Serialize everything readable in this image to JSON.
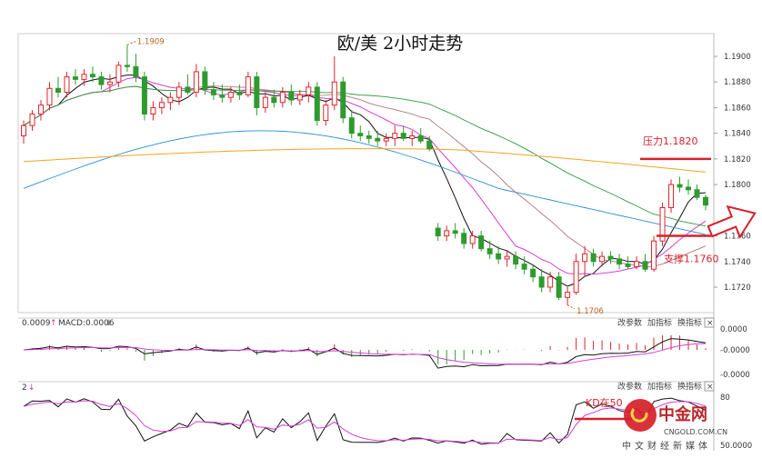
{
  "chart_data": {
    "type": "candlestick",
    "title": "欧/美 2小时走势",
    "y_ticks": [
      "1.1900",
      "1.1880",
      "1.1860",
      "1.1840",
      "1.1820",
      "1.1800",
      "1.1760",
      "1.1740",
      "1.1720"
    ],
    "ylim": [
      1.17,
      1.191
    ],
    "high_label": "1.1909",
    "low_label": "1.1706",
    "resistance": {
      "label": "压力1.1820",
      "value": 1.182
    },
    "support": {
      "label": "支撑1.1760",
      "value": 1.176
    },
    "candles": [
      [
        1.1838,
        1.185,
        1.1832,
        1.1846
      ],
      [
        1.1846,
        1.1858,
        1.1842,
        1.1855
      ],
      [
        1.1855,
        1.1866,
        1.185,
        1.1862
      ],
      [
        1.1862,
        1.188,
        1.1858,
        1.1875
      ],
      [
        1.1875,
        1.1884,
        1.1868,
        1.1872
      ],
      [
        1.1872,
        1.1888,
        1.1868,
        1.1884
      ],
      [
        1.1884,
        1.189,
        1.1878,
        1.1882
      ],
      [
        1.1882,
        1.189,
        1.1877,
        1.1886
      ],
      [
        1.1886,
        1.1892,
        1.188,
        1.1884
      ],
      [
        1.1884,
        1.1888,
        1.1874,
        1.1878
      ],
      [
        1.1878,
        1.1886,
        1.1872,
        1.188
      ],
      [
        1.188,
        1.1896,
        1.1876,
        1.1893
      ],
      [
        1.1893,
        1.1909,
        1.1888,
        1.1892
      ],
      [
        1.1892,
        1.1902,
        1.188,
        1.1884
      ],
      [
        1.1884,
        1.1888,
        1.185,
        1.1855
      ],
      [
        1.1855,
        1.1865,
        1.185,
        1.186
      ],
      [
        1.186,
        1.1868,
        1.1855,
        1.1864
      ],
      [
        1.1864,
        1.1872,
        1.1858,
        1.1868
      ],
      [
        1.1868,
        1.188,
        1.1862,
        1.1876
      ],
      [
        1.1876,
        1.1886,
        1.187,
        1.1872
      ],
      [
        1.1872,
        1.1894,
        1.1868,
        1.1888
      ],
      [
        1.1888,
        1.1892,
        1.187,
        1.1874
      ],
      [
        1.1874,
        1.188,
        1.1866,
        1.187
      ],
      [
        1.187,
        1.1878,
        1.1864,
        1.1868
      ],
      [
        1.1868,
        1.1876,
        1.1864,
        1.1872
      ],
      [
        1.1872,
        1.1878,
        1.1866,
        1.187
      ],
      [
        1.187,
        1.1888,
        1.1868,
        1.1884
      ],
      [
        1.1884,
        1.1888,
        1.1854,
        1.186
      ],
      [
        1.186,
        1.1872,
        1.1856,
        1.1868
      ],
      [
        1.1868,
        1.1874,
        1.186,
        1.1864
      ],
      [
        1.1864,
        1.1876,
        1.186,
        1.1872
      ],
      [
        1.1872,
        1.1878,
        1.1862,
        1.1866
      ],
      [
        1.1866,
        1.1874,
        1.1862,
        1.187
      ],
      [
        1.187,
        1.188,
        1.1864,
        1.1876
      ],
      [
        1.1876,
        1.188,
        1.1846,
        1.185
      ],
      [
        1.185,
        1.1866,
        1.1846,
        1.1862
      ],
      [
        1.1862,
        1.19,
        1.1858,
        1.188
      ],
      [
        1.188,
        1.1884,
        1.1848,
        1.1852
      ],
      [
        1.1852,
        1.1858,
        1.1836,
        1.184
      ],
      [
        1.184,
        1.1846,
        1.1834,
        1.1838
      ],
      [
        1.1838,
        1.1842,
        1.1832,
        1.1836
      ],
      [
        1.1836,
        1.1842,
        1.183,
        1.1834
      ],
      [
        1.1834,
        1.184,
        1.183,
        1.1836
      ],
      [
        1.1836,
        1.1846,
        1.183,
        1.184
      ],
      [
        1.184,
        1.1846,
        1.1834,
        1.1836
      ],
      [
        1.1836,
        1.1842,
        1.183,
        1.1838
      ],
      [
        1.1838,
        1.1844,
        1.1832,
        1.1834
      ],
      [
        1.1834,
        1.1838,
        1.1826,
        1.1828
      ],
      [
        1.1766,
        1.177,
        1.1756,
        1.176
      ],
      [
        1.176,
        1.1768,
        1.1756,
        1.1764
      ],
      [
        1.1764,
        1.177,
        1.1758,
        1.1762
      ],
      [
        1.1762,
        1.1766,
        1.175,
        1.1754
      ],
      [
        1.1754,
        1.1764,
        1.175,
        1.176
      ],
      [
        1.176,
        1.1764,
        1.1748,
        1.175
      ],
      [
        1.175,
        1.1756,
        1.1742,
        1.1746
      ],
      [
        1.1746,
        1.1752,
        1.1738,
        1.1742
      ],
      [
        1.1742,
        1.1748,
        1.1736,
        1.1744
      ],
      [
        1.1744,
        1.1748,
        1.1734,
        1.1738
      ],
      [
        1.1738,
        1.1744,
        1.173,
        1.1734
      ],
      [
        1.1734,
        1.1738,
        1.1724,
        1.1728
      ],
      [
        1.1728,
        1.1734,
        1.1716,
        1.172
      ],
      [
        1.172,
        1.1732,
        1.1716,
        1.1728
      ],
      [
        1.1728,
        1.1732,
        1.171,
        1.1712
      ],
      [
        1.1712,
        1.172,
        1.1706,
        1.1716
      ],
      [
        1.1716,
        1.1746,
        1.1714,
        1.174
      ],
      [
        1.174,
        1.1752,
        1.1728,
        1.1746
      ],
      [
        1.1746,
        1.175,
        1.1736,
        1.174
      ],
      [
        1.174,
        1.1748,
        1.1736,
        1.1744
      ],
      [
        1.1744,
        1.1748,
        1.1738,
        1.1742
      ],
      [
        1.1742,
        1.1746,
        1.1734,
        1.1738
      ],
      [
        1.1738,
        1.1744,
        1.1734,
        1.1736
      ],
      [
        1.1736,
        1.1744,
        1.1734,
        1.174
      ],
      [
        1.174,
        1.1746,
        1.1732,
        1.1734
      ],
      [
        1.1734,
        1.176,
        1.1732,
        1.1756
      ],
      [
        1.1756,
        1.1786,
        1.1752,
        1.1782
      ],
      [
        1.1782,
        1.1804,
        1.1778,
        1.18
      ],
      [
        1.18,
        1.1806,
        1.1794,
        1.1798
      ],
      [
        1.1798,
        1.1804,
        1.1792,
        1.1796
      ],
      [
        1.1796,
        1.18,
        1.1788,
        1.179
      ],
      [
        1.179,
        1.1792,
        1.178,
        1.1784
      ]
    ],
    "macd_label": "0.0009",
    "macd_value": "MACD:0.0006",
    "macd_ticks": [
      "0.0000",
      "-0.0000",
      "-0.0000"
    ],
    "kd_label": "2",
    "kd_note": "KD在50",
    "kd_ticks": [
      "80",
      "50.0000"
    ]
  },
  "toolbar": {
    "params": "改参数",
    "add": "加指标",
    "switch": "换指标",
    "close": "×"
  },
  "logo": {
    "cn": "中金网",
    "en": "CNGOLD.COM.CN",
    "sub": "中文财经新媒体"
  }
}
